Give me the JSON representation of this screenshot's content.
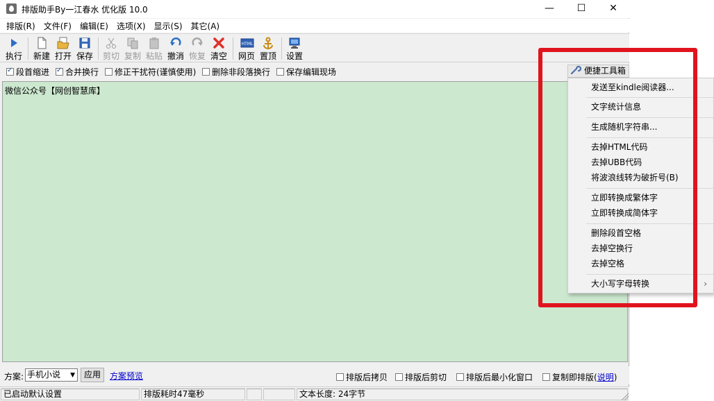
{
  "window": {
    "title": "排版助手By一江春水 优化版 10.0",
    "minimize": "—",
    "maximize": "☐",
    "close": "✕"
  },
  "menubar": [
    "排版(R)",
    "文件(F)",
    "编辑(E)",
    "选项(X)",
    "显示(S)",
    "其它(A)"
  ],
  "toolbar": {
    "run": "执行",
    "new": "新建",
    "open": "打开",
    "save": "保存",
    "cut": "剪切",
    "copy": "复制",
    "paste": "粘贴",
    "undo": "撤消",
    "redo": "恢复",
    "clear": "清空",
    "web": "网页",
    "top": "置顶",
    "settings": "设置",
    "html_badge": "HTML"
  },
  "options": {
    "indent": {
      "label": "段首缩进",
      "checked": true
    },
    "merge": {
      "label": "合并换行",
      "checked": true
    },
    "fix_chars": {
      "label": "修正干扰符(谨慎使用)",
      "checked": false
    },
    "remove_breaks": {
      "label": "删除非段落换行",
      "checked": false
    },
    "save_scene": {
      "label": "保存编辑现场",
      "checked": false
    },
    "toolbox": "便捷工具箱"
  },
  "editor": {
    "text": "微信公众号【网创智慧库】"
  },
  "bottom": {
    "scheme_label": "方案:",
    "scheme_value": "手机小说",
    "apply": "应用",
    "preview": "方案预览",
    "copy_after": "排版后拷贝",
    "cut_after": "排版后剪切",
    "minimize_after": "排版后最小化窗口",
    "copy_then_format": "复制即排版(",
    "help": "说明",
    "close_paren": ")"
  },
  "status": {
    "loaded": "已启动默认设置",
    "time": "排版耗时47毫秒",
    "length": "文本长度: 24字节"
  },
  "context_menu": [
    "发送至kindle阅读器...",
    "文字统计信息",
    "生成随机字符串...",
    "去掉HTML代码",
    "去掉UBB代码",
    "将波浪线转为破折号(B)",
    "立即转换成繁体字",
    "立即转换成简体字",
    "删除段首空格",
    "去掉空换行",
    "去掉空格",
    "大小写字母转换"
  ],
  "colors": {
    "editor_bg": "#cce8cf",
    "highlight": "#e0141e",
    "link": "#0000cc"
  }
}
